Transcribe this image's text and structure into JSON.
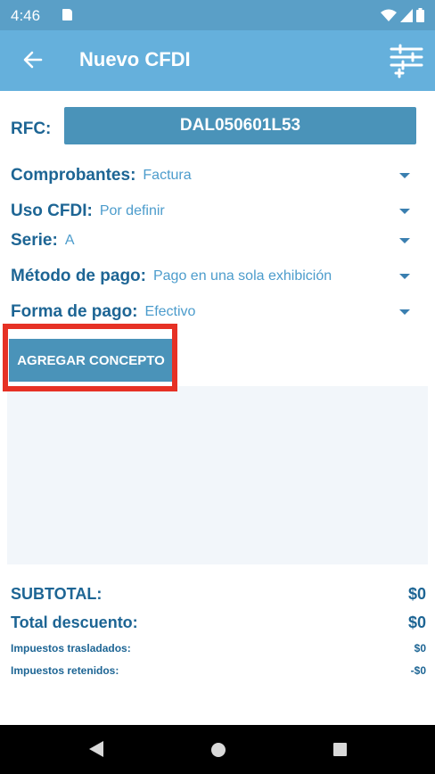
{
  "status_bar": {
    "time": "4:46",
    "icons": [
      "sim-card-icon",
      "wifi-icon",
      "signal-icon",
      "battery-icon"
    ]
  },
  "app_bar": {
    "title": "Nuevo CFDI",
    "back_icon": "arrow-left-icon",
    "action_icon": "filter-settings-icon",
    "color": "#65b0dc"
  },
  "form": {
    "rfc_label": "RFC:",
    "rfc_value": "DAL050601L53",
    "fields": [
      {
        "label": "Comprobantes:",
        "value": "Factura"
      },
      {
        "label": "Uso CFDI:",
        "value": "Por definir"
      },
      {
        "label": "Serie:",
        "value": "A"
      },
      {
        "label": "Método de pago:",
        "value": "Pago en una sola exhibición"
      },
      {
        "label": "Forma de pago:",
        "value": "Efectivo"
      }
    ]
  },
  "actions": {
    "agregar_concepto": "AGREGAR CONCEPTO",
    "highlight_color": "#e63125"
  },
  "totals": {
    "subtotal_label": "SUBTOTAL:",
    "subtotal_value": "$0",
    "descuento_label": "Total descuento:",
    "descuento_value": "$0",
    "trasladados_label": "Impuestos trasladados:",
    "trasladados_value": "$0",
    "retenidos_label": "Impuestos retenidos:",
    "retenidos_value": "-$0"
  },
  "nav_bar": {
    "icons": [
      "nav-back-icon",
      "nav-home-icon",
      "nav-recents-icon"
    ]
  },
  "colors": {
    "label": "#1d6594",
    "value": "#4c9ccc",
    "button": "#4a93b9"
  }
}
